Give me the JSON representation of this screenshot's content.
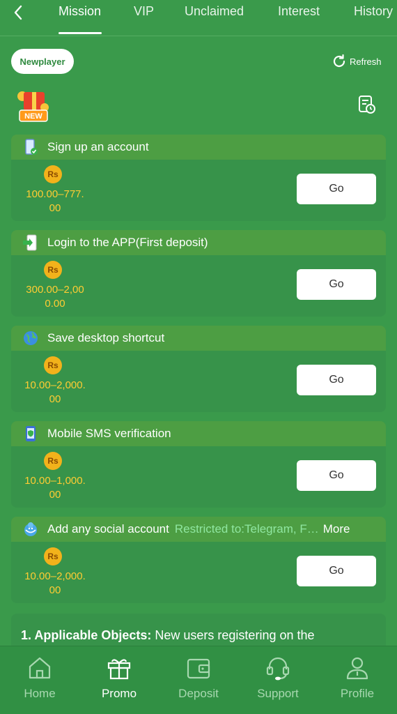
{
  "topnav": {
    "tabs": [
      {
        "label": "Mission",
        "active": true
      },
      {
        "label": "VIP",
        "active": false
      },
      {
        "label": "Unclaimed",
        "active": false
      },
      {
        "label": "Interest",
        "active": false
      },
      {
        "label": "History",
        "active": false
      }
    ]
  },
  "header": {
    "chip_label": "Newplayer",
    "refresh_label": "Refresh",
    "badge_text": "NEW"
  },
  "currency_symbol": "Rs",
  "go_label": "Go",
  "missions": [
    {
      "title": "Sign up an account",
      "icon": "signup-phone-icon",
      "amount": "100.00–777.00"
    },
    {
      "title": "Login to the APP(First deposit)",
      "icon": "app-login-icon",
      "amount": "300.00–2,000.00"
    },
    {
      "title": "Save desktop shortcut",
      "icon": "globe-icon",
      "amount": "10.00–2,000.00"
    },
    {
      "title": "Mobile SMS verification",
      "icon": "phone-shield-icon",
      "amount": "10.00–1,000.00"
    },
    {
      "title": "Add any social account",
      "icon": "social-bird-icon",
      "amount": "10.00–2,000.00",
      "restriction": "Restricted to:Telegram, F…",
      "more": "More"
    }
  ],
  "rules": {
    "heading": "1. Applicable Objects:",
    "text": " New users registering on the"
  },
  "bottomnav": {
    "items": [
      {
        "label": "Home",
        "icon": "home-icon",
        "active": false
      },
      {
        "label": "Promo",
        "icon": "gift-icon",
        "active": true
      },
      {
        "label": "Deposit",
        "icon": "wallet-icon",
        "active": false
      },
      {
        "label": "Support",
        "icon": "headset-icon",
        "active": false
      },
      {
        "label": "Profile",
        "icon": "profile-icon",
        "active": false
      }
    ]
  },
  "colors": {
    "background": "#3a9a4b",
    "card": "#37934a",
    "card_header": "#4d9e43",
    "amount": "#ffcc33",
    "coin": "#f2b21b",
    "restriction": "#8fe6a0"
  }
}
